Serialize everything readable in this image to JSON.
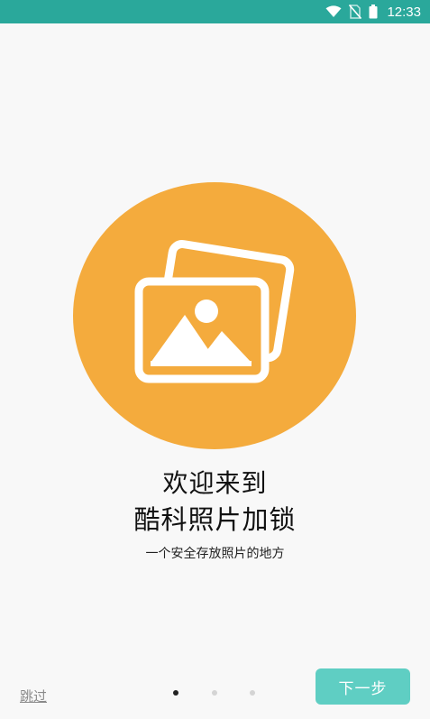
{
  "status_bar": {
    "time": "12:33",
    "icons": [
      "wifi-icon",
      "no-sim-icon",
      "battery-icon"
    ],
    "background": "#2aa89b"
  },
  "hero": {
    "icon": "photos-icon",
    "circle_color": "#f4ab3d"
  },
  "welcome": {
    "title_line_1": "欢迎来到",
    "title_line_2": "酷科照片加锁",
    "subtitle": "一个安全存放照片的地方"
  },
  "footer": {
    "skip_label": "跳过",
    "next_label": "下一步",
    "page_indicator": {
      "current": 1,
      "total": 3
    },
    "accent": "#5fcec3"
  }
}
